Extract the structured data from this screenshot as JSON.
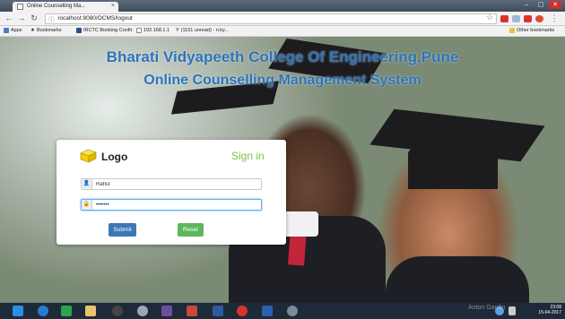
{
  "browser": {
    "tab_title": "Online Counselling Ma...",
    "tab_close": "×",
    "url": "localhost:8080/OCMS/logout",
    "bookmarks": [
      {
        "label": "Apps"
      },
      {
        "label": "Bookmarks"
      },
      {
        "label": "IRCTC Booking Confir"
      },
      {
        "label": "192.168.1.1"
      },
      {
        "label": "(1151 unread) - n.ky..."
      },
      {
        "label": "Other bookmarks"
      }
    ]
  },
  "page": {
    "title_line1": "Bharati Vidyapeeth College Of Engineering,Pune",
    "title_line2": "Online Counselling Management System"
  },
  "login": {
    "logo_label": "Logo",
    "heading": "Sign in",
    "username_value": "Rahul",
    "password_value": "•••••••",
    "submit_label": "Submit",
    "reset_label": "Reset"
  },
  "taskbar": {
    "time": "23:08",
    "date": "15-04-2017",
    "watermark": "Anton Gardin"
  },
  "colors": {
    "title": "#2c74b8",
    "signin": "#7dc24a",
    "submit": "#3a78b8",
    "reset": "#5cb85c",
    "logo_cube": "#f5d000"
  }
}
